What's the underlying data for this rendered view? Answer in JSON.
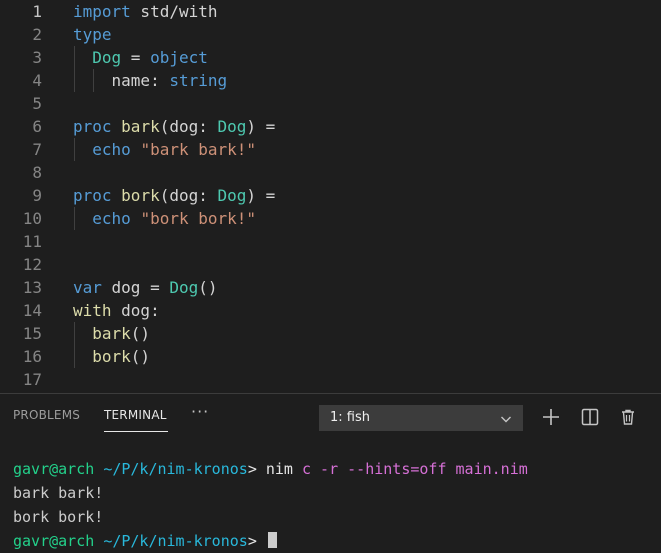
{
  "editor": {
    "active_line": 1,
    "lines": [
      {
        "n": "1",
        "tokens": [
          {
            "t": "import",
            "c": "kw"
          },
          {
            "t": " std/with",
            "c": "tx"
          }
        ]
      },
      {
        "n": "2",
        "tokens": [
          {
            "t": "type",
            "c": "kw"
          }
        ]
      },
      {
        "n": "3",
        "tokens": [
          {
            "t": "  ",
            "c": "tx"
          },
          {
            "t": "Dog",
            "c": "ty"
          },
          {
            "t": " = ",
            "c": "tx"
          },
          {
            "t": "object",
            "c": "kw"
          }
        ]
      },
      {
        "n": "4",
        "tokens": [
          {
            "t": "    name: ",
            "c": "tx"
          },
          {
            "t": "string",
            "c": "kw"
          }
        ]
      },
      {
        "n": "5",
        "tokens": []
      },
      {
        "n": "6",
        "tokens": [
          {
            "t": "proc",
            "c": "kw"
          },
          {
            "t": " ",
            "c": "tx"
          },
          {
            "t": "bark",
            "c": "fn"
          },
          {
            "t": "(dog: ",
            "c": "tx"
          },
          {
            "t": "Dog",
            "c": "ty"
          },
          {
            "t": ") =",
            "c": "tx"
          }
        ]
      },
      {
        "n": "7",
        "tokens": [
          {
            "t": "  ",
            "c": "tx"
          },
          {
            "t": "echo",
            "c": "kw"
          },
          {
            "t": " ",
            "c": "tx"
          },
          {
            "t": "\"bark bark!\"",
            "c": "st"
          }
        ]
      },
      {
        "n": "8",
        "tokens": []
      },
      {
        "n": "9",
        "tokens": [
          {
            "t": "proc",
            "c": "kw"
          },
          {
            "t": " ",
            "c": "tx"
          },
          {
            "t": "bork",
            "c": "fn"
          },
          {
            "t": "(dog: ",
            "c": "tx"
          },
          {
            "t": "Dog",
            "c": "ty"
          },
          {
            "t": ") =",
            "c": "tx"
          }
        ]
      },
      {
        "n": "10",
        "tokens": [
          {
            "t": "  ",
            "c": "tx"
          },
          {
            "t": "echo",
            "c": "kw"
          },
          {
            "t": " ",
            "c": "tx"
          },
          {
            "t": "\"bork bork!\"",
            "c": "st"
          }
        ]
      },
      {
        "n": "11",
        "tokens": []
      },
      {
        "n": "12",
        "tokens": []
      },
      {
        "n": "13",
        "tokens": [
          {
            "t": "var",
            "c": "kw"
          },
          {
            "t": " dog = ",
            "c": "tx"
          },
          {
            "t": "Dog",
            "c": "ty"
          },
          {
            "t": "()",
            "c": "tx"
          }
        ]
      },
      {
        "n": "14",
        "tokens": [
          {
            "t": "with",
            "c": "fn"
          },
          {
            "t": " dog:",
            "c": "tx"
          }
        ]
      },
      {
        "n": "15",
        "tokens": [
          {
            "t": "  ",
            "c": "tx"
          },
          {
            "t": "bark",
            "c": "fn"
          },
          {
            "t": "()",
            "c": "tx"
          }
        ]
      },
      {
        "n": "16",
        "tokens": [
          {
            "t": "  ",
            "c": "tx"
          },
          {
            "t": "bork",
            "c": "fn"
          },
          {
            "t": "()",
            "c": "tx"
          }
        ]
      },
      {
        "n": "17",
        "tokens": []
      }
    ]
  },
  "panel": {
    "tabs": {
      "problems": "PROBLEMS",
      "terminal": "TERMINAL"
    },
    "more_icon": "more-icon",
    "terminal_select": {
      "selected": "1: fish"
    },
    "toolbar_icons": [
      "plus-icon",
      "split-icon",
      "trash-icon"
    ]
  },
  "terminal": {
    "prompt": {
      "user_host": "gavr@arch",
      "path": "~/P/k/nim-kronos",
      "symbol": ">"
    },
    "command": {
      "program": "nim",
      "args": "c -r --hints=off main.nim"
    },
    "output": [
      "bark bark!",
      "bork bork!"
    ]
  },
  "colors": {
    "keyword": "#569cd6",
    "type": "#4ec9b0",
    "function": "#dcdcaa",
    "string": "#ce9178",
    "prompt_green": "#23d18b",
    "prompt_path": "#29b8db",
    "argument_pink": "#d670d6"
  }
}
